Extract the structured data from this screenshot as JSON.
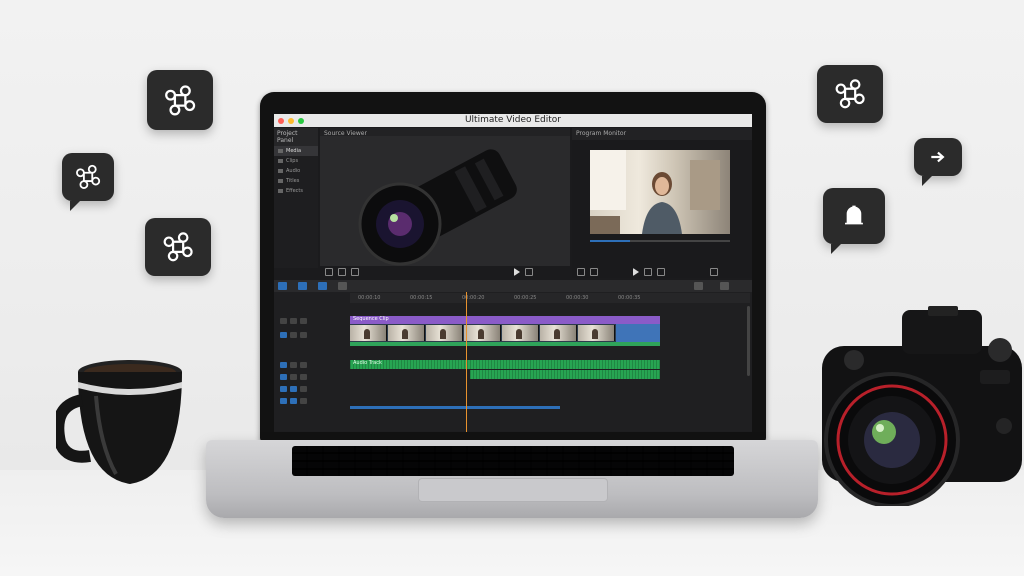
{
  "app": {
    "title": "Ultimate Video Editor",
    "bin_header": "Project Panel",
    "bin_items": [
      "Media",
      "Clips",
      "Audio",
      "Titles",
      "Effects"
    ],
    "source_header": "Source Viewer",
    "program_header": "Program Monitor",
    "clip_label": "Sequence Clip",
    "audio_label": "Audio Track",
    "ruler_ticks": [
      "00:00:10",
      "00:00:15",
      "00:00:20",
      "00:00:25",
      "00:00:30",
      "00:00:35"
    ]
  },
  "colors": {
    "accent": "#2d6fb8",
    "clip_purple": "#8a5bc8",
    "audio_green": "#27a552",
    "playhead": "#e8922e"
  },
  "icons": {
    "shortcut": "command-key-icon",
    "arrow": "arrow-right-icon",
    "bell": "bell-icon"
  }
}
